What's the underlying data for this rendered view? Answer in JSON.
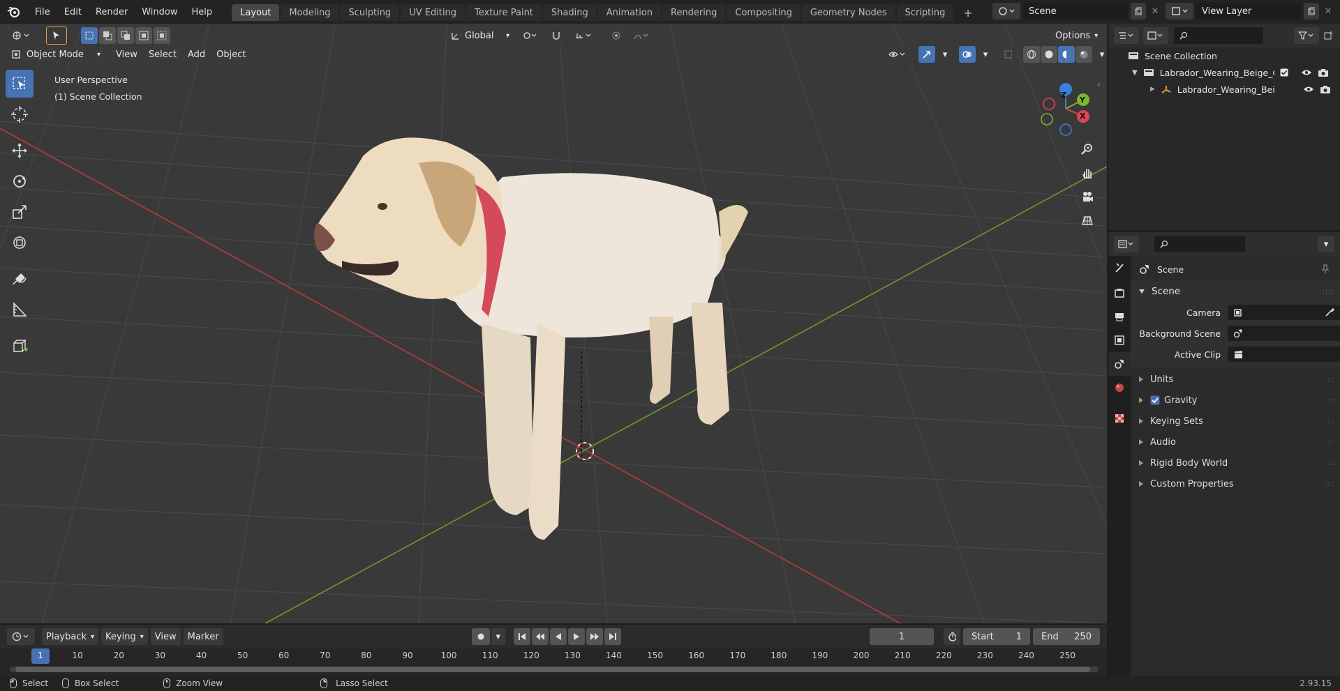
{
  "menu": {
    "file": "File",
    "edit": "Edit",
    "render": "Render",
    "window": "Window",
    "help": "Help"
  },
  "workspaces": [
    "Layout",
    "Modeling",
    "Sculpting",
    "UV Editing",
    "Texture Paint",
    "Shading",
    "Animation",
    "Rendering",
    "Compositing",
    "Geometry Nodes",
    "Scripting"
  ],
  "scene_field": "Scene",
  "view_layer_field": "View Layer",
  "viewport": {
    "transform_orientation": "Global",
    "options_label": "Options",
    "mode": "Object Mode",
    "menus": {
      "view": "View",
      "select": "Select",
      "add": "Add",
      "object": "Object"
    },
    "overlay_text_1": "User Perspective",
    "overlay_text_2": "(1) Scene Collection",
    "gizmo": {
      "x": "X",
      "y": "Y",
      "z": "Z"
    }
  },
  "outliner": {
    "root": "Scene Collection",
    "collection": "Labrador_Wearing_Beige_Co",
    "object": "Labrador_Wearing_Beige"
  },
  "properties": {
    "header": "Scene",
    "panel": "Scene",
    "camera_label": "Camera",
    "background_scene_label": "Background Scene",
    "active_clip_label": "Active Clip",
    "subpanels": {
      "units": "Units",
      "gravity": "Gravity",
      "keying_sets": "Keying Sets",
      "audio": "Audio",
      "rigid_body_world": "Rigid Body World",
      "custom_properties": "Custom Properties"
    },
    "gravity_checked": true
  },
  "timeline": {
    "menus": {
      "playback": "Playback",
      "keying": "Keying",
      "view": "View",
      "marker": "Marker"
    },
    "current_frame": "1",
    "start_label": "Start",
    "start_value": "1",
    "end_label": "End",
    "end_value": "250",
    "ruler": [
      "1",
      "10",
      "20",
      "30",
      "40",
      "50",
      "60",
      "70",
      "80",
      "90",
      "100",
      "110",
      "120",
      "130",
      "140",
      "150",
      "160",
      "170",
      "180",
      "190",
      "200",
      "210",
      "220",
      "230",
      "240",
      "250"
    ]
  },
  "statusbar": {
    "select": "Select",
    "box_select": "Box Select",
    "zoom_view": "Zoom View",
    "lasso_select": "Lasso Select",
    "version": "2.93.15"
  },
  "colors": {
    "accent": "#4772b3",
    "x_axis": "#b83a3a",
    "y_axis": "#6e9a2c",
    "z_axis": "#3a7fe0"
  }
}
